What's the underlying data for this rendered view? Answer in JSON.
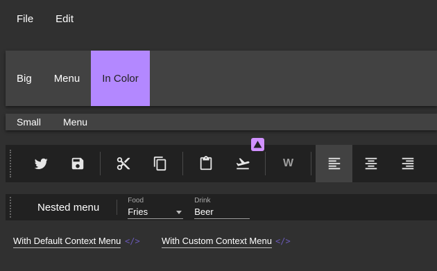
{
  "top_menu": {
    "items": [
      "File",
      "Edit"
    ]
  },
  "big_menu": {
    "items": [
      "Big",
      "Menu",
      "In Color"
    ]
  },
  "small_menu": {
    "items": [
      "Small",
      "Menu"
    ]
  },
  "toolbar": {
    "icons": [
      "twitter-icon",
      "save-icon",
      "cut-icon",
      "copy-icon",
      "paste-icon",
      "flight-takeoff-icon",
      "word-icon",
      "align-left-icon",
      "align-center-icon",
      "align-right-icon"
    ],
    "word_letter": "W",
    "badge_icon": "warning-icon"
  },
  "nested": {
    "label": "Nested menu",
    "food": {
      "label": "Food",
      "value": "Fries"
    },
    "drink": {
      "label": "Drink",
      "value": "Beer"
    }
  },
  "context": {
    "default_label": "With Default Context Menu",
    "custom_label": "With Custom Context Menu",
    "code_icon": "</>"
  },
  "colors": {
    "accent": "#b388ff",
    "badge": "#d191ff",
    "bg": "#303030",
    "toolbar_bg": "#212121"
  }
}
